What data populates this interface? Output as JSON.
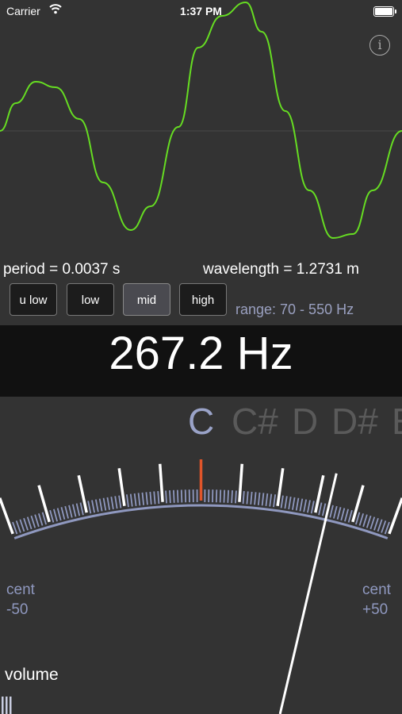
{
  "status_bar": {
    "carrier": "Carrier",
    "time": "1:37 PM",
    "battery_level": 1.0
  },
  "info_button": {
    "glyph": "i"
  },
  "readouts": {
    "period": "period = 0.0037 s",
    "wavelength": "wavelength = 1.2731 m"
  },
  "range_buttons": [
    {
      "label": "u low",
      "active": false
    },
    {
      "label": "low",
      "active": false
    },
    {
      "label": "mid",
      "active": true
    },
    {
      "label": "high",
      "active": false
    }
  ],
  "range_text": "range: 70 - 550 Hz",
  "frequency": "267.2 Hz",
  "notes": [
    {
      "label": "C",
      "current": true
    },
    {
      "label": "C#",
      "current": false
    },
    {
      "label": "D",
      "current": false
    },
    {
      "label": "D#",
      "current": false
    },
    {
      "label": "E",
      "current": false
    }
  ],
  "cents": {
    "left_label": "cent",
    "left_value": "-50",
    "right_label": "cent",
    "right_value": "+50",
    "needle_value": 33
  },
  "volume": {
    "label": "volume"
  },
  "colors": {
    "wave": "#66dd22",
    "center_tick": "#e0552a",
    "scale_arc": "#8f98bf",
    "range_text": "#9aa0c0"
  }
}
